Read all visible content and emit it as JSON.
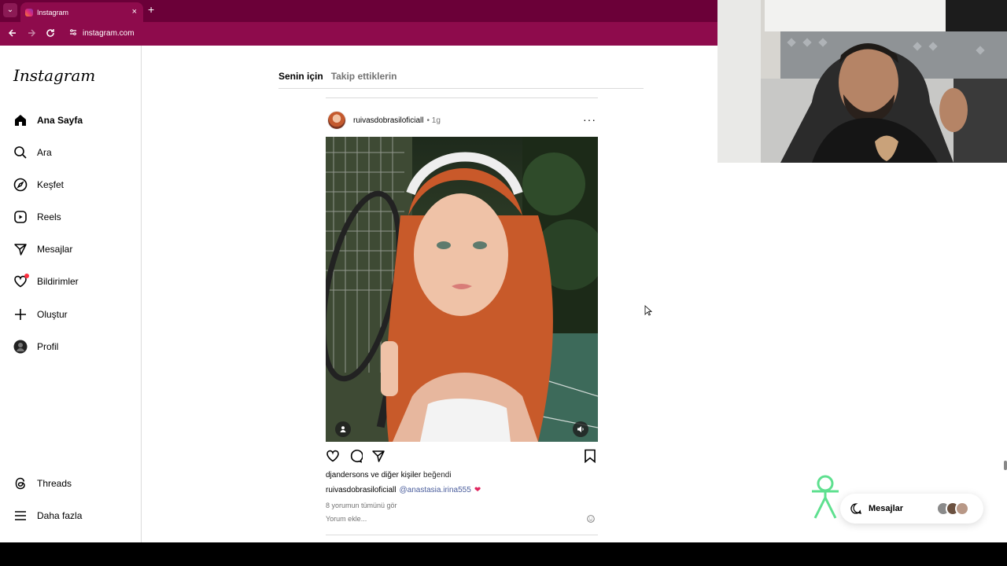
{
  "browser": {
    "tab_title": "Instagram",
    "tab_close": "×",
    "new_tab": "+",
    "url": "instagram.com"
  },
  "sidebar": {
    "logo": "Instagram",
    "items": [
      {
        "label": "Ana Sayfa",
        "icon": "home-icon"
      },
      {
        "label": "Ara",
        "icon": "search-icon"
      },
      {
        "label": "Keşfet",
        "icon": "compass-icon"
      },
      {
        "label": "Reels",
        "icon": "reels-icon"
      },
      {
        "label": "Mesajlar",
        "icon": "send-icon"
      },
      {
        "label": "Bildirimler",
        "icon": "heart-icon"
      },
      {
        "label": "Oluştur",
        "icon": "plus-icon"
      },
      {
        "label": "Profil",
        "icon": "avatar-icon"
      },
      {
        "label": "Threads",
        "icon": "threads-icon"
      },
      {
        "label": "Daha fazla",
        "icon": "menu-icon"
      }
    ]
  },
  "feed": {
    "tabs": [
      "Senin için",
      "Takip ettiklerin"
    ]
  },
  "post": {
    "username": "ruivasdobrasiloficiall",
    "time": "• 1g",
    "more": "···",
    "liked_by_user": "djandersons",
    "liked_by_conj": "ve",
    "liked_by_others": "diğer kişiler",
    "liked_suffix": "beğendi",
    "caption_user": "ruivasdobrasiloficiall",
    "caption_mention": "@anastasia.irina555",
    "caption_emoji": "❤",
    "view_comments": "8 yorumun tümünü gör",
    "add_comment_placeholder": "Yorum ekle..."
  },
  "messages_pill": {
    "label": "Mesajlar"
  },
  "colors": {
    "browser_tabbar": "#6b0038",
    "browser_toolbar": "#8e0b4c",
    "notification_dot": "#ff3040",
    "mention": "#4a5d9c"
  }
}
